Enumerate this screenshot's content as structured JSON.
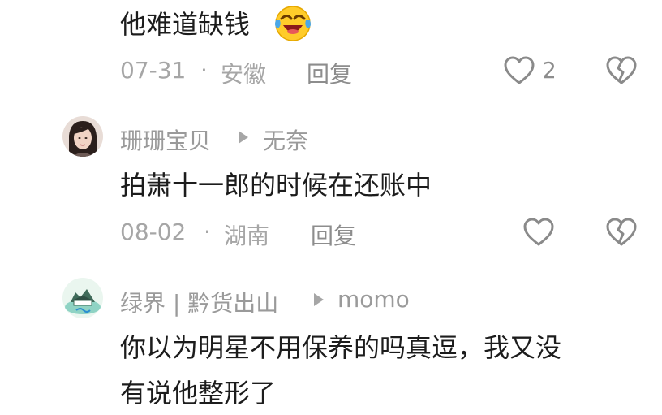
{
  "comments": [
    {
      "text": "他难道缺钱",
      "emoji": "laughing-crying-emoji",
      "date": "07-31",
      "separator": "·",
      "location": "安徽",
      "reply_label": "回复",
      "like_count": "2"
    },
    {
      "author": "珊珊宝贝",
      "reply_to": "无奈",
      "text": "拍萧十一郎的时候在还账中",
      "date": "08-02",
      "separator": "·",
      "location": "湖南",
      "reply_label": "回复"
    },
    {
      "author": "绿界 | 黔货出山",
      "reply_to": "momo",
      "text_line1": "你以为明星不用保养的吗真逗，我又没",
      "text_line2": "有说他整形了"
    }
  ],
  "icons": {
    "like": "heart-outline-icon",
    "dislike": "broken-heart-icon",
    "reply_arrow": "play-triangle-icon"
  },
  "colors": {
    "text": "#1c1c1c",
    "meta": "#a6a6a6",
    "icon": "#8a8a8a",
    "background": "#ffffff"
  }
}
